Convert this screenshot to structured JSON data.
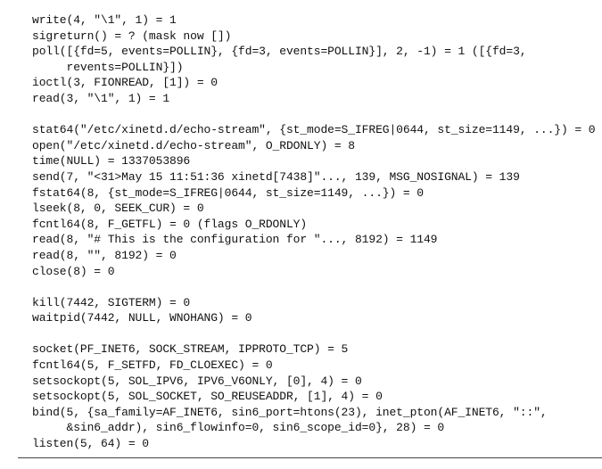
{
  "lines": [
    "write(4, \"\\1\", 1) = 1",
    "sigreturn() = ? (mask now [])",
    "poll([{fd=5, events=POLLIN}, {fd=3, events=POLLIN}], 2, -1) = 1 ([{fd=3,",
    "     revents=POLLIN}])",
    "ioctl(3, FIONREAD, [1]) = 0",
    "read(3, \"\\1\", 1) = 1",
    "",
    "stat64(\"/etc/xinetd.d/echo-stream\", {st_mode=S_IFREG|0644, st_size=1149, ...}) = 0",
    "open(\"/etc/xinetd.d/echo-stream\", O_RDONLY) = 8",
    "time(NULL) = 1337053896",
    "send(7, \"<31>May 15 11:51:36 xinetd[7438]\"..., 139, MSG_NOSIGNAL) = 139",
    "fstat64(8, {st_mode=S_IFREG|0644, st_size=1149, ...}) = 0",
    "lseek(8, 0, SEEK_CUR) = 0",
    "fcntl64(8, F_GETFL) = 0 (flags O_RDONLY)",
    "read(8, \"# This is the configuration for \"..., 8192) = 1149",
    "read(8, \"\", 8192) = 0",
    "close(8) = 0",
    "",
    "kill(7442, SIGTERM) = 0",
    "waitpid(7442, NULL, WNOHANG) = 0",
    "",
    "socket(PF_INET6, SOCK_STREAM, IPPROTO_TCP) = 5",
    "fcntl64(5, F_SETFD, FD_CLOEXEC) = 0",
    "setsockopt(5, SOL_IPV6, IPV6_V6ONLY, [0], 4) = 0",
    "setsockopt(5, SOL_SOCKET, SO_REUSEADDR, [1], 4) = 0",
    "bind(5, {sa_family=AF_INET6, sin6_port=htons(23), inet_pton(AF_INET6, \"::\",",
    "     &sin6_addr), sin6_flowinfo=0, sin6_scope_id=0}, 28) = 0",
    "listen(5, 64) = 0"
  ]
}
